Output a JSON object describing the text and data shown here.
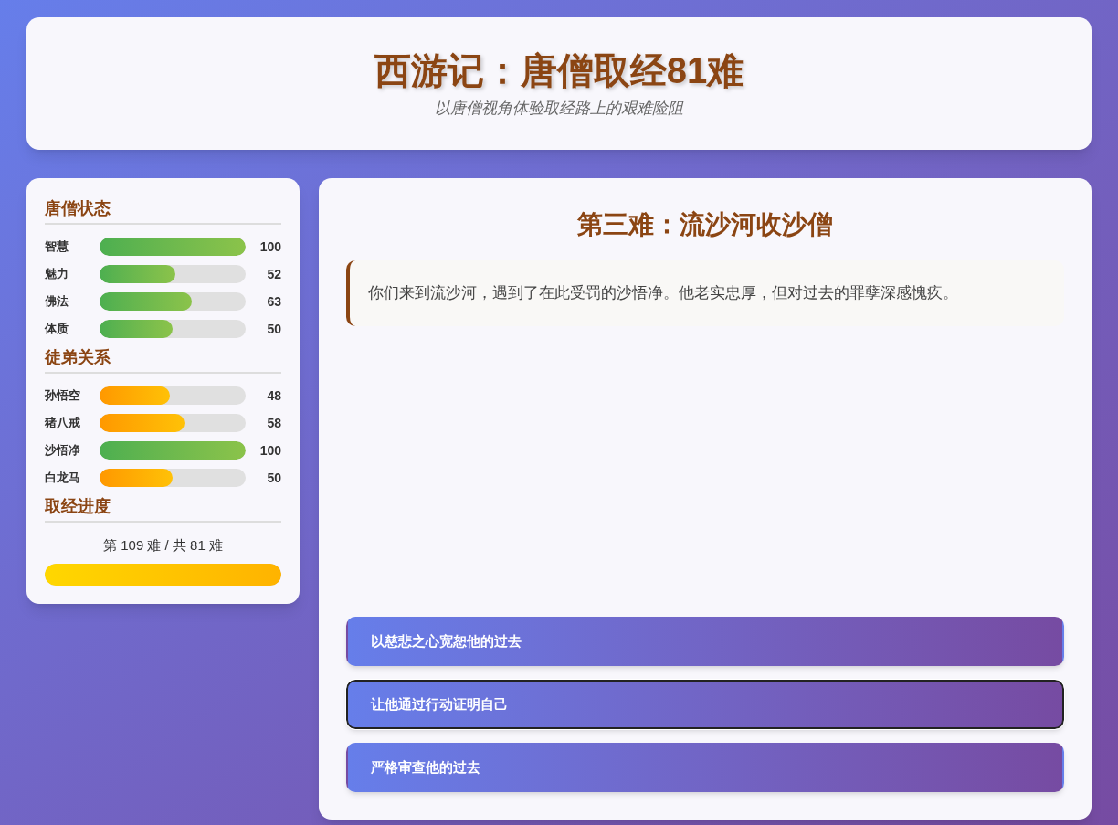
{
  "header": {
    "title": "西游记：唐僧取经81难",
    "subtitle": "以唐僧视角体验取经路上的艰难险阻"
  },
  "sidebar": {
    "sections": [
      {
        "title": "唐僧状态",
        "stats": [
          {
            "label": "智慧",
            "level": 1,
            "value": "100",
            "kind": "high"
          },
          {
            "label": "魅力",
            "level": 0.52,
            "value": "52",
            "kind": "high"
          },
          {
            "label": "佛法",
            "level": 0.63,
            "value": "63",
            "kind": "high"
          },
          {
            "label": "体质",
            "level": 0.5,
            "value": "50",
            "kind": "high"
          }
        ]
      },
      {
        "title": "徒弟关系",
        "stats": [
          {
            "label": "孙悟空",
            "level": 0.48,
            "value": "48",
            "kind": "low"
          },
          {
            "label": "猪八戒",
            "level": 0.58,
            "value": "58",
            "kind": "low"
          },
          {
            "label": "沙悟净",
            "level": 1,
            "value": "100",
            "kind": "high"
          },
          {
            "label": "白龙马",
            "level": 0.5,
            "value": "50",
            "kind": "low"
          }
        ]
      }
    ],
    "progress": {
      "title": "取经进度",
      "text": "第 109 难 / 共 81 难",
      "level": 1
    }
  },
  "scene": {
    "title": "第三难：流沙河收沙僧",
    "story": "你们来到流沙河，遇到了在此受罚的沙悟净。他老实忠厚，但对过去的罪孽深感愧疚。",
    "choices": [
      {
        "label": "以慈悲之心宽恕他的过去",
        "focused": false
      },
      {
        "label": "让他通过行动证明自己",
        "focused": true
      },
      {
        "label": "严格审查他的过去",
        "focused": false
      }
    ]
  }
}
